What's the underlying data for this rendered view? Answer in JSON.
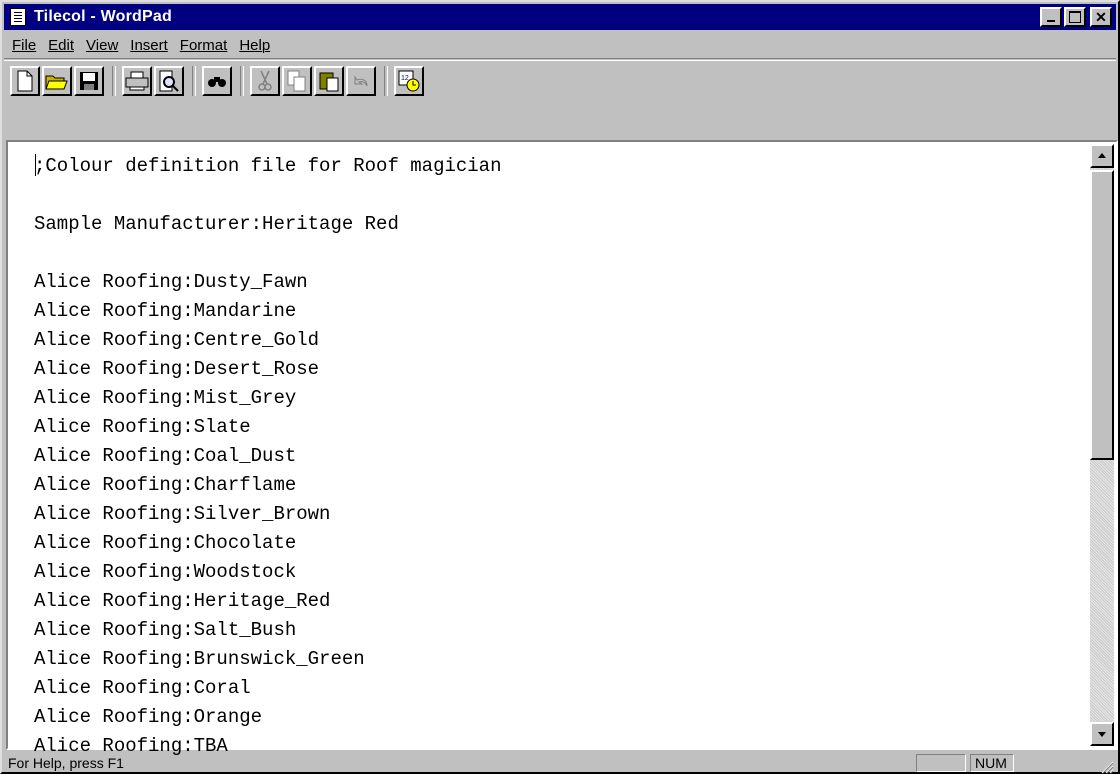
{
  "window": {
    "title": "Tilecol - WordPad"
  },
  "menu": {
    "items": [
      "File",
      "Edit",
      "View",
      "Insert",
      "Format",
      "Help"
    ]
  },
  "toolbar": {
    "buttons": [
      "new-icon",
      "open-icon",
      "save-icon",
      "print-icon",
      "print-preview-icon",
      "find-icon",
      "cut-icon",
      "copy-icon",
      "paste-icon",
      "undo-icon",
      "date-time-icon"
    ]
  },
  "document": {
    "lines": [
      ";Colour definition file for Roof magician",
      "",
      "Sample Manufacturer:Heritage Red",
      "",
      "Alice Roofing:Dusty_Fawn",
      "Alice Roofing:Mandarine",
      "Alice Roofing:Centre_Gold",
      "Alice Roofing:Desert_Rose",
      "Alice Roofing:Mist_Grey",
      "Alice Roofing:Slate",
      "Alice Roofing:Coal_Dust",
      "Alice Roofing:Charflame",
      "Alice Roofing:Silver_Brown",
      "Alice Roofing:Chocolate",
      "Alice Roofing:Woodstock",
      "Alice Roofing:Heritage_Red",
      "Alice Roofing:Salt_Bush",
      "Alice Roofing:Brunswick_Green",
      "Alice Roofing:Coral",
      "Alice Roofing:Orange",
      "Alice Roofing:TBA"
    ]
  },
  "statusbar": {
    "help_text": "For Help, press F1",
    "num_indicator": "NUM"
  },
  "colors": {
    "titlebar": "#000080",
    "face": "#c0c0c0"
  }
}
